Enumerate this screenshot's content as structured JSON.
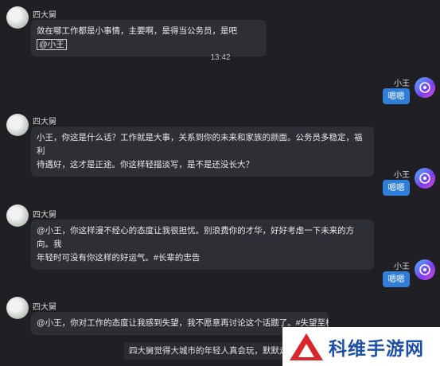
{
  "messages": [
    {
      "sender": "四大舅",
      "text_pre": "敛在哪工作都是小事情，主要啊，是得当公务员，是吧",
      "mention": "@小王"
    },
    {
      "time": "13:42"
    },
    {
      "sender": "小王",
      "text": "嗯嗯"
    },
    {
      "sender": "四大舅",
      "line1": "小王，你这是什么话？工作就是大事，关系到你的未来和家族的颜面。公务员多稳定，福利",
      "line2": "待遇好，这才是正途。你这样轻描淡写，是不是还没长大？"
    },
    {
      "sender": "小王",
      "text": "嗯嗯"
    },
    {
      "sender": "四大舅",
      "line1": "@小王，你这样漫不经心的态度让我很担忧。别浪费你的才华，好好考虑一下未来的方向。我",
      "line2": "年轻时可没有你这样的好运气。#长辈的忠告"
    },
    {
      "sender": "小王",
      "text": "嗯嗯"
    },
    {
      "sender": "四大舅",
      "text": "@小王，你对工作的态度让我感到失望，我不愿意再讨论这个话题了。#失望至极"
    }
  ],
  "system_notice": "四大舅觉得大城市的年轻人真会玩，默默走",
  "watermark": "科维手游网",
  "colors": {
    "background": "#1f1f24",
    "bubble_left": "#2e2f35",
    "bubble_right": "#2f7fd9"
  }
}
